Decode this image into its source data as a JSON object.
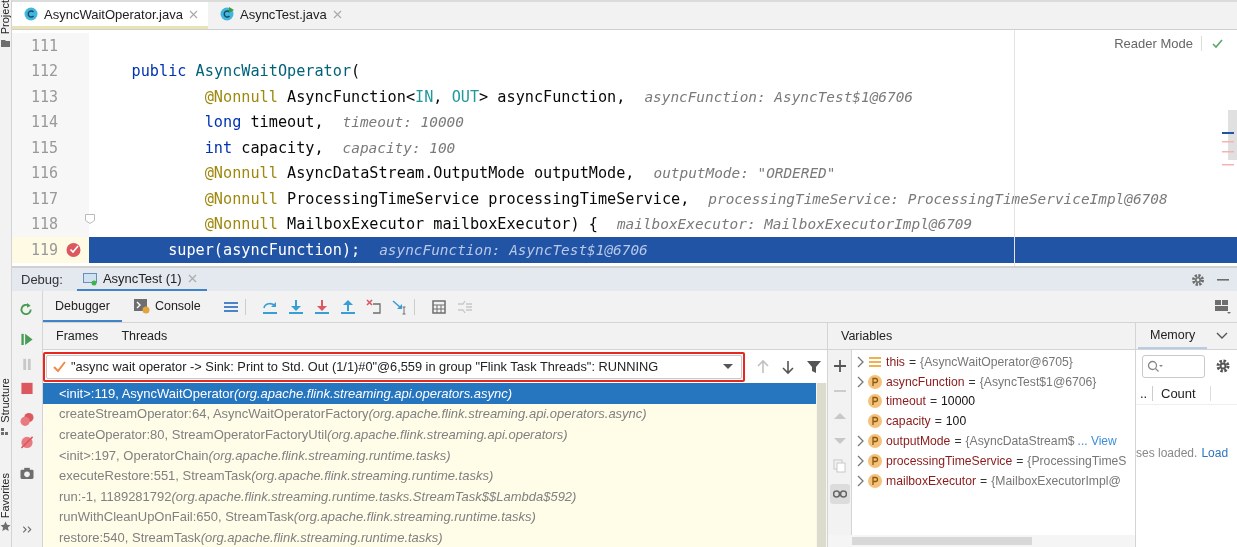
{
  "tool_strip": [
    {
      "label": "Project",
      "kind": "project"
    },
    {
      "label": "Structure",
      "kind": "structure"
    },
    {
      "label": "Favorites",
      "kind": "favorites"
    }
  ],
  "editor_tabs": [
    {
      "title": "AsyncWaitOperator.java",
      "kind": "class",
      "selected": true
    },
    {
      "title": "AsyncTest.java",
      "kind": "test",
      "selected": false
    }
  ],
  "editor": {
    "reader_mode": "Reader Mode",
    "lines": [
      {
        "number": "111",
        "selected": false,
        "breakpoint": false,
        "fold": false
      },
      {
        "number": "112",
        "code": [
          {
            "text": "    public ",
            "kind": "keyword"
          },
          {
            "text": "AsyncWaitOperator",
            "kind": "method"
          },
          {
            "text": "(",
            "kind": "plain"
          }
        ],
        "selected": false,
        "breakpoint": false,
        "fold": false
      },
      {
        "number": "113",
        "code": [
          {
            "text": "            @Nonnull ",
            "kind": "annotation"
          },
          {
            "text": "AsyncFunction<",
            "kind": "plain"
          },
          {
            "text": "IN",
            "kind": "type-param"
          },
          {
            "text": ", ",
            "kind": "plain"
          },
          {
            "text": "OUT",
            "kind": "type-param"
          },
          {
            "text": "> asyncFunction,",
            "kind": "plain"
          }
        ],
        "hint": "asyncFunction: AsyncTest$1@6706",
        "selected": false,
        "breakpoint": false,
        "fold": false
      },
      {
        "number": "114",
        "code": [
          {
            "text": "            long ",
            "kind": "keyword"
          },
          {
            "text": "timeout,",
            "kind": "plain"
          }
        ],
        "hint": "timeout: 10000",
        "selected": false,
        "breakpoint": false,
        "fold": false
      },
      {
        "number": "115",
        "code": [
          {
            "text": "            int ",
            "kind": "keyword"
          },
          {
            "text": "capacity,",
            "kind": "plain"
          }
        ],
        "hint": "capacity: 100",
        "selected": false,
        "breakpoint": false,
        "fold": false
      },
      {
        "number": "116",
        "code": [
          {
            "text": "            @Nonnull ",
            "kind": "annotation"
          },
          {
            "text": "AsyncDataStream.OutputMode outputMode,",
            "kind": "plain"
          }
        ],
        "hint": "outputMode: \"ORDERED\"",
        "selected": false,
        "breakpoint": false,
        "fold": false
      },
      {
        "number": "117",
        "code": [
          {
            "text": "            @Nonnull ",
            "kind": "annotation"
          },
          {
            "text": "ProcessingTimeService processingTimeService,",
            "kind": "plain"
          }
        ],
        "hint": "processingTimeService: ProcessingTimeServiceImpl@6708",
        "selected": false,
        "breakpoint": false,
        "fold": false
      },
      {
        "number": "118",
        "code": [
          {
            "text": "            @Nonnull ",
            "kind": "annotation"
          },
          {
            "text": "MailboxExecutor mailboxExecutor) {",
            "kind": "plain"
          }
        ],
        "hint": "mailboxExecutor: MailboxExecutorImpl@6709",
        "selected": false,
        "breakpoint": false,
        "fold": true
      },
      {
        "number": "119",
        "code": [
          {
            "text": "        super(asyncFunction);",
            "kind": "plain"
          }
        ],
        "hint": "asyncFunction: AsyncTest$1@6706",
        "selected": true,
        "breakpoint": true,
        "fold": false
      }
    ]
  },
  "debug": {
    "label": "Debug:",
    "session": "AsyncTest (1)",
    "tabs": [
      {
        "label": "Debugger",
        "kind": "debugger",
        "selected": true
      },
      {
        "label": "Console",
        "kind": "console",
        "selected": false
      }
    ],
    "frames_header": [
      "Frames",
      "Threads"
    ],
    "thread": "\"async wait operator -> Sink: Print to Std. Out (1/1)#0\"@6,559 in group \"Flink Task Threads\": RUNNING",
    "frames": [
      {
        "method": "<init>:119, AsyncWaitOperator",
        "package": "(org.apache.flink.streaming.api.operators.async)",
        "selected": true
      },
      {
        "method": "createStreamOperator:64, AsyncWaitOperatorFactory",
        "package": "(org.apache.flink.streaming.api.operators.async)",
        "selected": false
      },
      {
        "method": "createOperator:80, StreamOperatorFactoryUtil",
        "package": "(org.apache.flink.streaming.api.operators)",
        "selected": false
      },
      {
        "method": "<init>:197, OperatorChain",
        "package": "(org.apache.flink.streaming.runtime.tasks)",
        "selected": false
      },
      {
        "method": "executeRestore:551, StreamTask",
        "package": "(org.apache.flink.streaming.runtime.tasks)",
        "selected": false
      },
      {
        "method": "run:-1, 1189281792",
        "package": "(org.apache.flink.streaming.runtime.tasks.StreamTask$$Lambda$592)",
        "selected": false
      },
      {
        "method": "runWithCleanUpOnFail:650, StreamTask",
        "package": "(org.apache.flink.streaming.runtime.tasks)",
        "selected": false
      },
      {
        "method": "restore:540, StreamTask",
        "package": "(org.apache.flink.streaming.runtime.tasks)",
        "selected": false
      }
    ],
    "variables_title": "Variables",
    "variables": [
      {
        "name": "this",
        "operator": "=",
        "value": "{AsyncWaitOperator@6705}",
        "kind": "this",
        "has_children": true
      },
      {
        "name": "asyncFunction",
        "operator": "=",
        "value": "{AsyncTest$1@6706}",
        "kind": "field",
        "has_children": true
      },
      {
        "name": "timeout",
        "operator": "=",
        "value": "10000",
        "kind": "field",
        "has_children": false
      },
      {
        "name": "capacity",
        "operator": "=",
        "value": "100",
        "kind": "field",
        "has_children": false
      },
      {
        "name": "outputMode",
        "operator": "=",
        "value": "{AsyncDataStream$",
        "link": "... View",
        "kind": "field",
        "has_children": true
      },
      {
        "name": "processingTimeService",
        "operator": "=",
        "value": "{ProcessingTimeS",
        "kind": "field",
        "has_children": true
      },
      {
        "name": "mailboxExecutor",
        "operator": "=",
        "value": "{MailboxExecutorImpl@",
        "kind": "field",
        "has_children": true
      }
    ],
    "memory": {
      "title": "Memory",
      "column_1": "..",
      "column_2": "Count",
      "message": "ses loaded.",
      "link": "Load"
    }
  }
}
